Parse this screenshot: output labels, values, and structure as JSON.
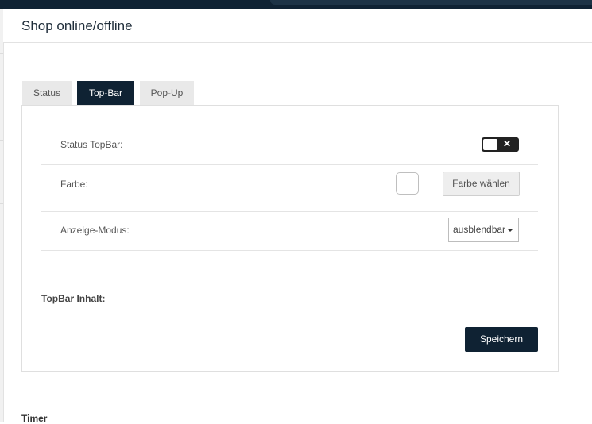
{
  "header": {
    "title": "Shop online/offline"
  },
  "tabs": [
    {
      "label": "Status",
      "active": false
    },
    {
      "label": "Top-Bar",
      "active": true
    },
    {
      "label": "Pop-Up",
      "active": false
    }
  ],
  "topbar_settings": {
    "status_label": "Status TopBar:",
    "status_enabled": false,
    "toggle_off_glyph": "✕",
    "color_label": "Farbe:",
    "color_value": "#ffffff",
    "choose_color_label": "Farbe wählen",
    "mode_label": "Anzeige-Modus:",
    "mode_value": "ausblendbar"
  },
  "content_label": "TopBar Inhalt:",
  "save_label": "Speichern",
  "next_section_label": "Timer",
  "colors": {
    "navy": "#0f2233",
    "tab_inactive": "#e9e9e9"
  }
}
